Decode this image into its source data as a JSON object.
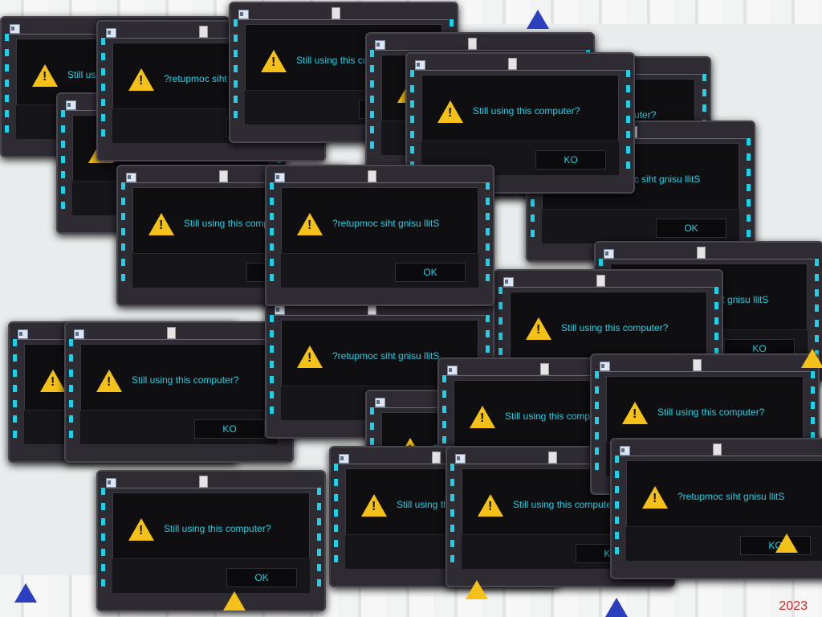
{
  "dialog": {
    "message": "Still using this computer?",
    "message_reversed": "?retupmoc siht gnisu llitS",
    "ok_label": "OK",
    "ok_label_reversed": "KO"
  },
  "taskbar": {
    "date_text": "2023"
  },
  "colors": {
    "dialog_frame": "#2e2b33",
    "dialog_body": "#0f0f12",
    "accent_cyan": "#1fd0e4",
    "warning_yellow": "#f3c117",
    "date_red": "#cc2a2a"
  },
  "icons": {
    "warning": "warning-icon",
    "app": "window-icon",
    "close": "close-icon"
  }
}
